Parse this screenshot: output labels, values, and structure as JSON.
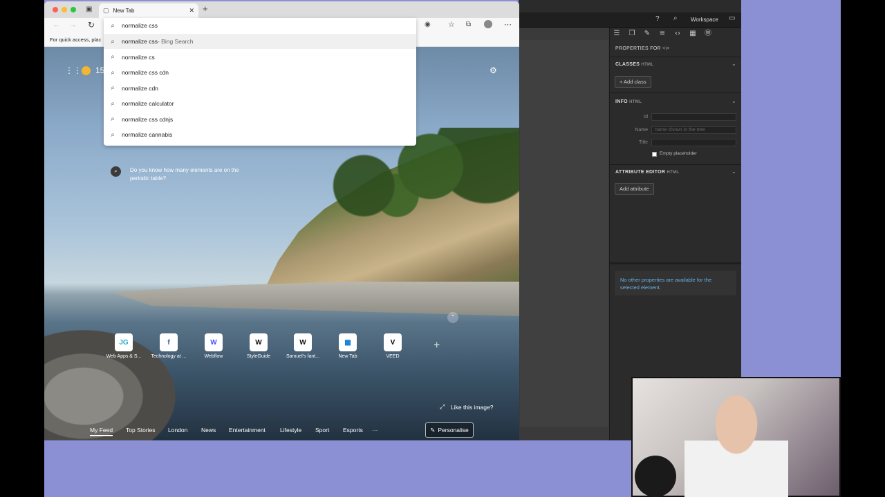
{
  "browser": {
    "tab_title": "New Tab",
    "address_value": "normalize css",
    "favbar_text": "For quick access, plac",
    "suggestions": [
      {
        "text": "normalize css",
        "suffix": " - Bing Search"
      },
      {
        "text": "normalize cs",
        "suffix": ""
      },
      {
        "text": "normalize css cdn",
        "suffix": ""
      },
      {
        "text": "normalize cdn",
        "suffix": ""
      },
      {
        "text": "normalize calculator",
        "suffix": ""
      },
      {
        "text": "normalize css cdnjs",
        "suffix": ""
      },
      {
        "text": "normalize cannabis",
        "suffix": ""
      }
    ],
    "weather_temp": "15",
    "question": "Do you know how many elements are on the periodic table?",
    "tiles": [
      {
        "label": "Web Apps & S...",
        "glyph": "JG",
        "color": "#2aa7c9"
      },
      {
        "label": "Technology at ...",
        "glyph": "f",
        "color": "#3b5998"
      },
      {
        "label": "Webflow",
        "glyph": "W",
        "color": "#4353ff"
      },
      {
        "label": "StyleGuide",
        "glyph": "W",
        "color": "#111111"
      },
      {
        "label": "Samuel's fant...",
        "glyph": "W",
        "color": "#111111"
      },
      {
        "label": "New Tab",
        "glyph": "▦",
        "color": "#0078d4"
      },
      {
        "label": "VEED",
        "glyph": "V",
        "color": "#000000"
      }
    ],
    "like_image": "Like this image?",
    "feed_nav": [
      "My Feed",
      "Top Stories",
      "London",
      "News",
      "Entertainment",
      "Lifestyle",
      "Sport",
      "Esports",
      "···"
    ],
    "personalise": "Personalise"
  },
  "editor": {
    "workspace": "Workspace",
    "properties_for": "PROPERTIES FOR",
    "properties_tag": "<i>",
    "classes_head": "CLASSES",
    "classes_sub": "HTML",
    "add_class": "+ Add class",
    "info_head": "INFO",
    "info_sub": "HTML",
    "id_label": "Id",
    "name_label": "Name",
    "name_placeholder": "name shown in the tree",
    "title_label": "Title",
    "empty_placeholder": "Empty placeholder",
    "attr_head": "ATTRIBUTE EDITOR",
    "attr_sub": "HTML",
    "add_attribute": "Add attribute",
    "no_props": "No other properties are available for the selected element."
  }
}
